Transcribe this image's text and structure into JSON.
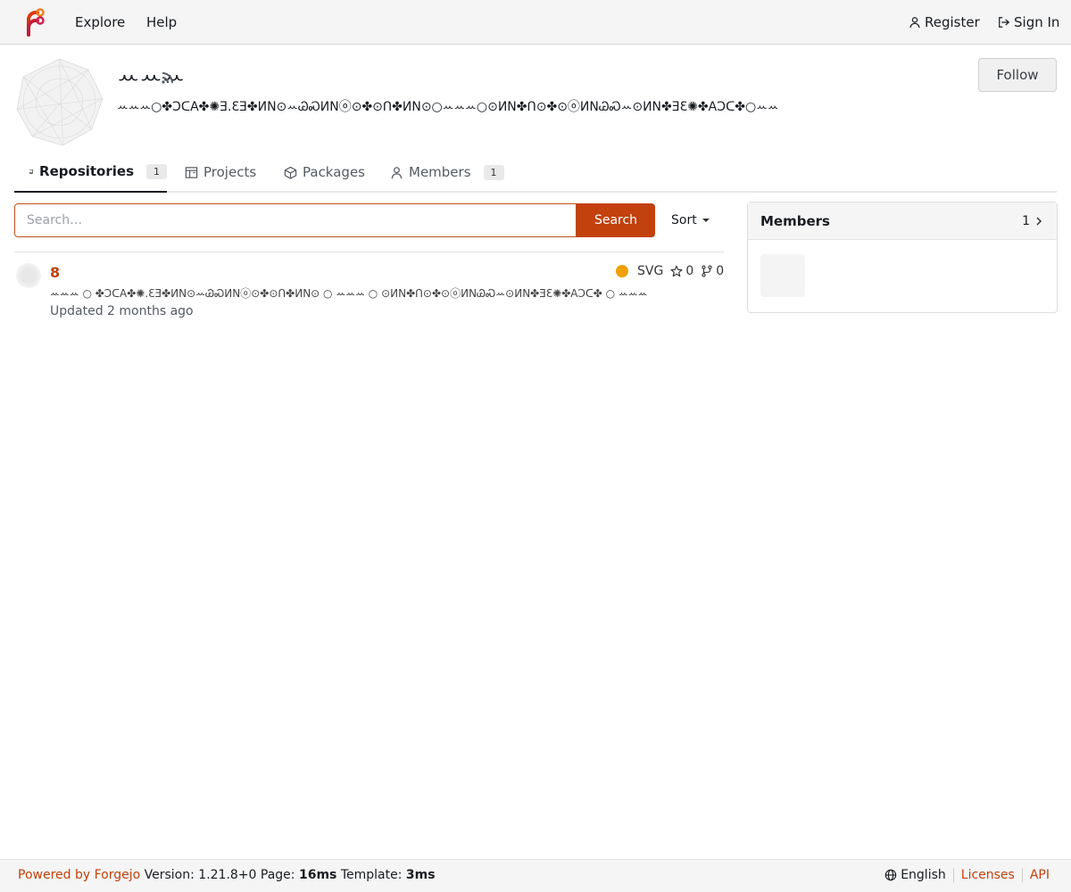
{
  "navbar": {
    "explore": "Explore",
    "help": "Help",
    "register": "Register",
    "sign_in": "Sign In"
  },
  "org": {
    "name": "ꕀꕀꕀ",
    "description": "ꕀꕀꕀ○✤ↃᑕA✤✺Ǝ.ƐƎ✤ИN⊙ꕀᏊᏍИNⓞ⊙✤⊙ᑎ✤ИN⊙○ꕀꕀꕀ○⊙ИN✤ᑎ⊙✤⊙ⓞИNᏊᏍꕀ⊙ИN✤ƎƐ✺✤AↃᑕ✤○ꕀꕀꕀ",
    "follow": "Follow"
  },
  "tabs": [
    {
      "label": "Repositories",
      "count": "1"
    },
    {
      "label": "Projects"
    },
    {
      "label": "Packages"
    },
    {
      "label": "Members",
      "count": "1"
    }
  ],
  "search": {
    "placeholder": "Search…",
    "button": "Search",
    "sort": "Sort"
  },
  "repo": {
    "name": "8",
    "language": "SVG",
    "stars": "0",
    "forks": "0",
    "description": "ꕀꕀꕀ ○ ✤ↃᑕA✤✺.ƐƎ✤ИN⊙ꕀᏊᏍИNⓞ⊙✤⊙ᑎ✤ИN⊙ ○ ꕀꕀꕀ ○ ⊙ИN✤ᑎ⊙✤⊙ⓞИNᏊᏍꕀ⊙ИN✤ƎƐ✺✤AↃᑕ✤ ○ ꕀꕀꕀ",
    "updated": "Updated 2 months ago"
  },
  "members": {
    "title": "Members",
    "count": "1"
  },
  "footer": {
    "powered": "Powered by Forgejo",
    "version": "Version: 1.21.8+0 Page:",
    "page_time": "16ms",
    "template_label": "Template:",
    "template_time": "3ms",
    "language": "English",
    "licenses": "Licenses",
    "api": "API"
  },
  "colors": {
    "accent": "#c2410c",
    "language_dot": "#f0a000"
  }
}
